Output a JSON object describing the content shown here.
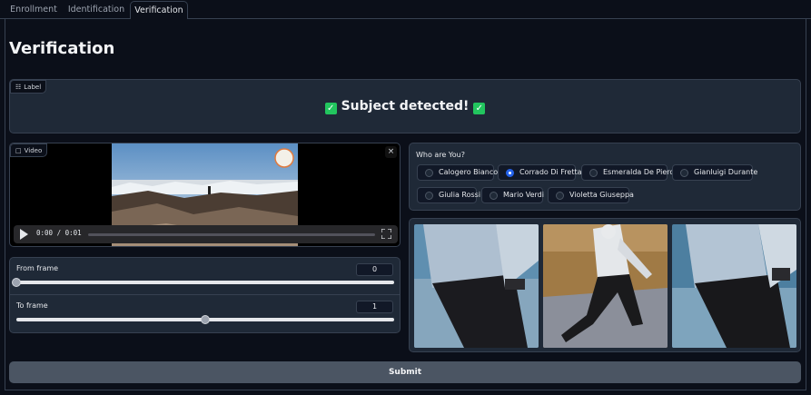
{
  "tabs": [
    {
      "label": "Enrollment"
    },
    {
      "label": "Identification"
    },
    {
      "label": "Verification"
    }
  ],
  "page_title": "Verification",
  "label_block": {
    "tag": "Label",
    "text": "Subject detected!",
    "check_icon": "white-check-mark-emoji"
  },
  "video": {
    "tag": "Video",
    "time": "0:00 / 0:01",
    "close_glyph": "×"
  },
  "sliders": {
    "from": {
      "label": "From frame",
      "value": "0",
      "fraction": 0.0
    },
    "to": {
      "label": "To frame",
      "value": "1",
      "fraction": 0.5
    }
  },
  "radio": {
    "title": "Who are You?",
    "options": [
      {
        "label": "Calogero Bianco",
        "selected": false
      },
      {
        "label": "Corrado Di Fretta",
        "selected": true
      },
      {
        "label": "Esmeralda De Piero",
        "selected": false
      },
      {
        "label": "Gianluigi Durante",
        "selected": false
      },
      {
        "label": "Giulia Rossi",
        "selected": false
      },
      {
        "label": "Mario Verdi",
        "selected": false
      },
      {
        "label": "Violetta Giuseppa",
        "selected": false
      }
    ]
  },
  "submit_label": "Submit",
  "colors": {
    "background": "#0b0f19",
    "panel": "#1f2937",
    "border": "#374151",
    "accent": "#2563eb",
    "success": "#22c55e",
    "button": "#4b5563"
  }
}
